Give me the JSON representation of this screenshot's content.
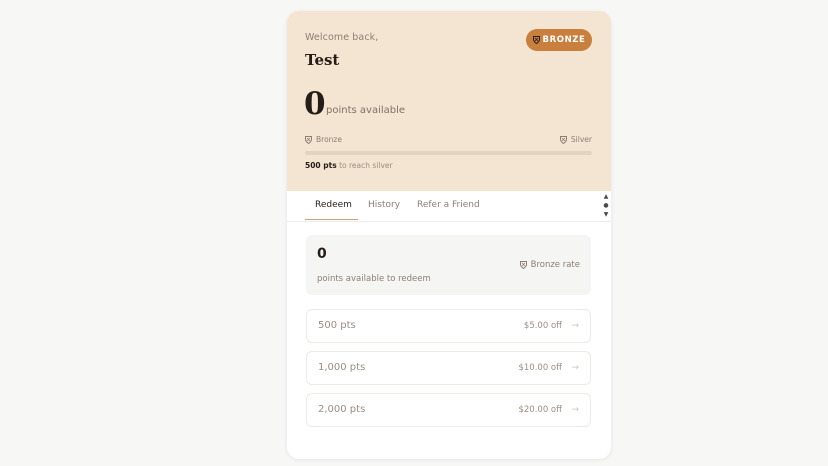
{
  "header": {
    "welcome": "Welcome back,",
    "username": "Test",
    "tier_badge": "BRONZE",
    "points": "0",
    "points_label": "points available"
  },
  "progress": {
    "current_tier": "Bronze",
    "next_tier": "Silver",
    "fraction": 0,
    "needed_pts": "500 pts",
    "needed_suffix": "to reach silver"
  },
  "tabs": [
    {
      "label": "Redeem"
    },
    {
      "label": "History"
    },
    {
      "label": "Refer a Friend"
    }
  ],
  "redeem": {
    "value": "0",
    "label": "points available to redeem",
    "rate": "Bronze rate"
  },
  "options": [
    {
      "points": "500 pts",
      "value": "$5.00 off"
    },
    {
      "points": "1,000 pts",
      "value": "$10.00 off"
    },
    {
      "points": "2,000 pts",
      "value": "$20.00 off"
    }
  ],
  "colors": {
    "accent": "#c97f3d",
    "hero_bg": "#f4e4d2"
  },
  "icons": {
    "tier": "shield-icon",
    "arrow": "arrow-right-icon",
    "scroll": "scroll-arrows-icon"
  }
}
